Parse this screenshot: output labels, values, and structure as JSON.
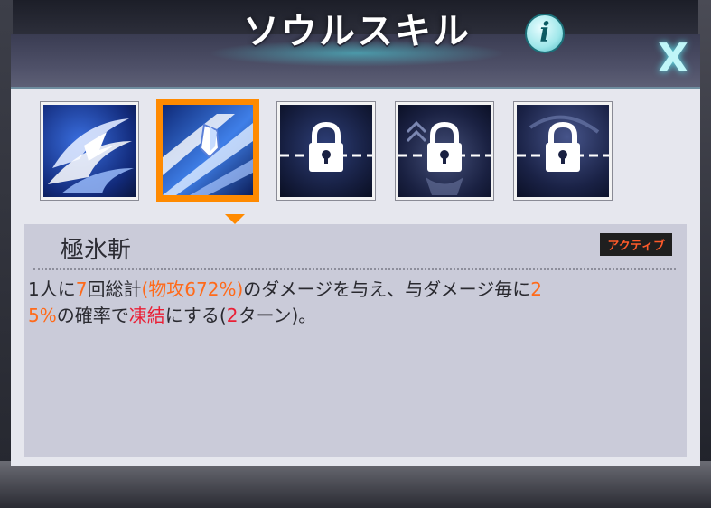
{
  "title": "ソウルスキル",
  "info_glyph": "i",
  "close_glyph": "X",
  "skills": [
    {
      "icon": "wind-slash-icon",
      "locked": false,
      "selected": false
    },
    {
      "icon": "ice-slash-icon",
      "locked": false,
      "selected": true
    },
    {
      "icon": "lock-icon",
      "locked": true,
      "selected": false
    },
    {
      "icon": "lock-icon",
      "locked": true,
      "selected": false
    },
    {
      "icon": "lock-icon",
      "locked": true,
      "selected": false
    }
  ],
  "detail": {
    "name": "極氷斬",
    "tag": "アクティブ",
    "segments": [
      {
        "text": "1人に",
        "style": "normal"
      },
      {
        "text": "7",
        "style": "orange"
      },
      {
        "text": "回総計",
        "style": "normal"
      },
      {
        "text": "(物攻672%)",
        "style": "orange"
      },
      {
        "text": "のダメージを与え、与ダメージ毎に",
        "style": "normal"
      },
      {
        "text": "2",
        "style": "orange"
      },
      {
        "text": "5%",
        "style": "orange"
      },
      {
        "text": "の確率で",
        "style": "normal"
      },
      {
        "text": "凍結",
        "style": "red"
      },
      {
        "text": "にする(",
        "style": "normal"
      },
      {
        "text": "2",
        "style": "red"
      },
      {
        "text": "ターン)。",
        "style": "normal"
      }
    ]
  },
  "colors": {
    "selected_border": "#ff8a00",
    "highlight_orange": "#ff6a1a",
    "highlight_red": "#ea1f35",
    "tag_text": "#ff5a2a"
  }
}
